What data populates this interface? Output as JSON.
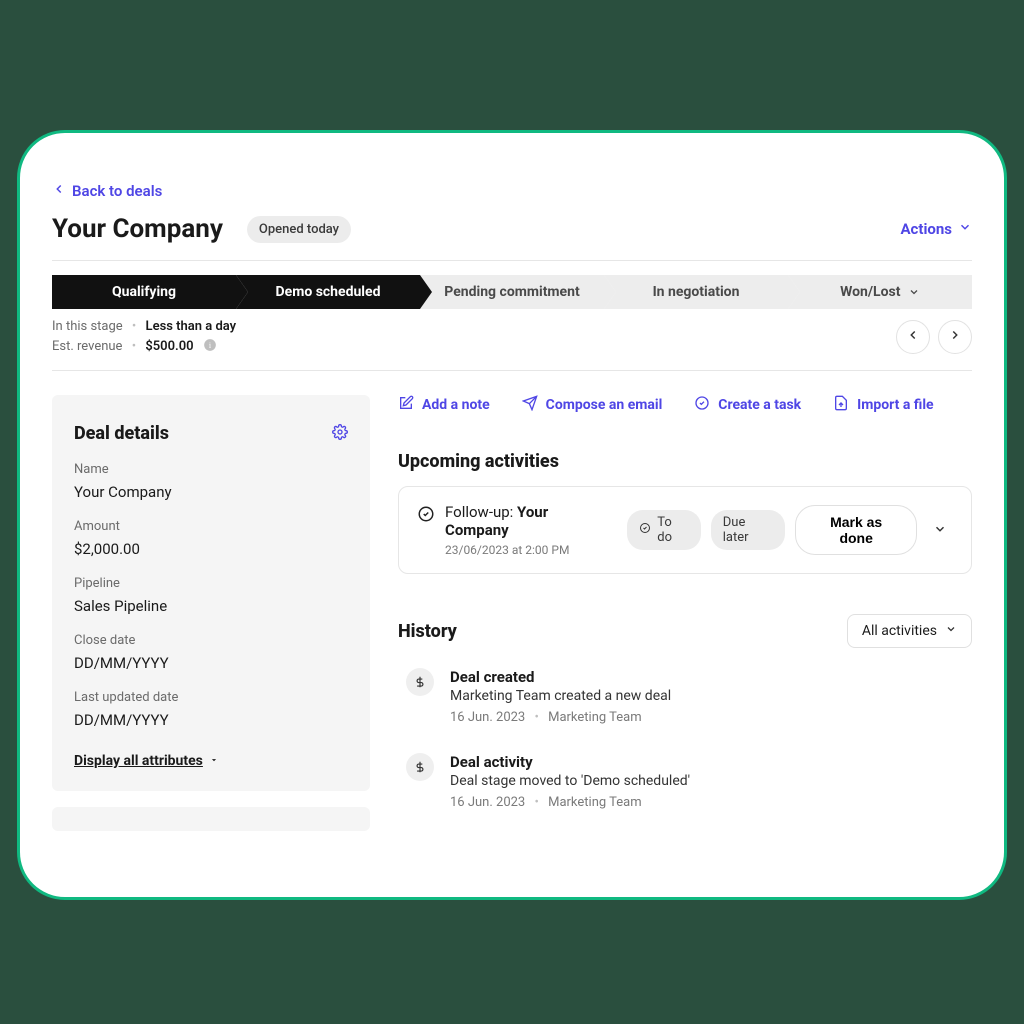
{
  "nav": {
    "back_label": "Back to deals"
  },
  "header": {
    "title": "Your Company",
    "status_badge": "Opened today",
    "actions_label": "Actions"
  },
  "pipeline": {
    "stages": [
      {
        "label": "Qualifying",
        "active": true
      },
      {
        "label": "Demo scheduled",
        "active": true
      },
      {
        "label": "Pending commitment",
        "active": false
      },
      {
        "label": "In negotiation",
        "active": false
      },
      {
        "label": "Won/Lost",
        "active": false,
        "has_dropdown": true
      }
    ],
    "meta": {
      "in_stage_label": "In this stage",
      "in_stage_value": "Less than a day",
      "revenue_label": "Est. revenue",
      "revenue_value": "$500.00"
    }
  },
  "deal_details": {
    "title": "Deal details",
    "fields": {
      "name_label": "Name",
      "name_value": "Your Company",
      "amount_label": "Amount",
      "amount_value": "$2,000.00",
      "pipeline_label": "Pipeline",
      "pipeline_value": "Sales Pipeline",
      "close_date_label": "Close date",
      "close_date_value": "DD/MM/YYYY",
      "updated_label": "Last updated date",
      "updated_value": "DD/MM/YYYY"
    },
    "display_all_label": "Display all attributes"
  },
  "quick_actions": {
    "add_note": "Add a note",
    "compose_email": "Compose an email",
    "create_task": "Create a task",
    "import_file": "Import a file"
  },
  "upcoming": {
    "title": "Upcoming activities",
    "item": {
      "prefix": "Follow-up: ",
      "company": "Your Company",
      "datetime": "23/06/2023 at 2:00 PM",
      "todo_label": "To do",
      "due_label": "Due later",
      "done_label": "Mark as done"
    }
  },
  "history": {
    "title": "History",
    "filter_label": "All activities",
    "items": [
      {
        "title": "Deal created",
        "desc": "Marketing Team created a new deal",
        "date": "16 Jun. 2023",
        "author": "Marketing Team"
      },
      {
        "title": "Deal activity",
        "desc": "Deal stage moved to 'Demo scheduled'",
        "date": "16 Jun. 2023",
        "author": "Marketing Team"
      }
    ]
  }
}
